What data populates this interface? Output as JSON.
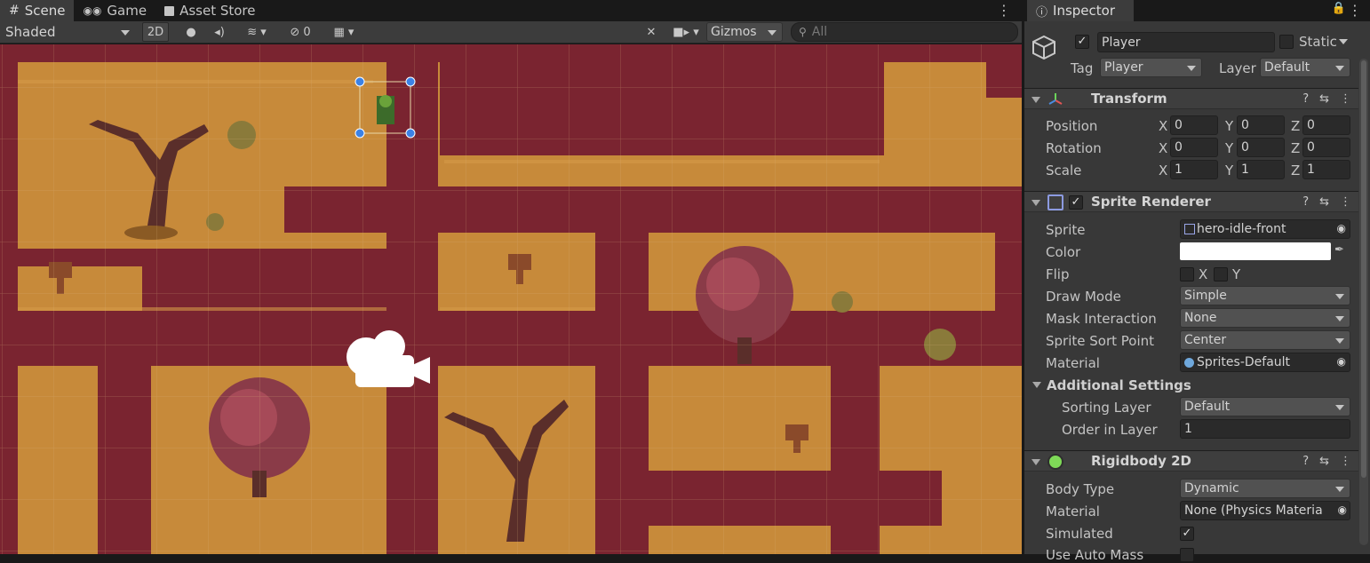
{
  "tabs": [
    {
      "icon": "grid-icon",
      "label": "Scene"
    },
    {
      "icon": "gamepad-icon",
      "label": "Game"
    },
    {
      "icon": "store-bag-icon",
      "label": "Asset Store"
    }
  ],
  "inspector_tab": {
    "label": "Inspector"
  },
  "scene_toolbar": {
    "draw_mode": "Shaded",
    "mode_2d": "2D",
    "hidden_count": "0",
    "gizmos": "Gizmos",
    "search_placeholder": "All"
  },
  "game_object": {
    "name": "Player",
    "static_label": "Static",
    "tag_label": "Tag",
    "tag_value": "Player",
    "layer_label": "Layer",
    "layer_value": "Default"
  },
  "transform": {
    "title": "Transform",
    "rows": [
      {
        "label": "Position",
        "x": "0",
        "y": "0",
        "z": "0"
      },
      {
        "label": "Rotation",
        "x": "0",
        "y": "0",
        "z": "0"
      },
      {
        "label": "Scale",
        "x": "1",
        "y": "1",
        "z": "1"
      }
    ],
    "axis": {
      "x": "X",
      "y": "Y",
      "z": "Z"
    }
  },
  "sprite_renderer": {
    "title": "Sprite Renderer",
    "sprite_label": "Sprite",
    "sprite_value": "hero-idle-front",
    "color_label": "Color",
    "color_value": "#ffffff",
    "flip_label": "Flip",
    "flip_x": "X",
    "flip_y": "Y",
    "draw_mode_label": "Draw Mode",
    "draw_mode_value": "Simple",
    "mask_label": "Mask Interaction",
    "mask_value": "None",
    "sort_point_label": "Sprite Sort Point",
    "sort_point_value": "Center",
    "material_label": "Material",
    "material_value": "Sprites-Default",
    "additional_label": "Additional Settings",
    "sorting_layer_label": "Sorting Layer",
    "sorting_layer_value": "Default",
    "order_label": "Order in Layer",
    "order_value": "1"
  },
  "rigidbody": {
    "title": "Rigidbody 2D",
    "body_type_label": "Body Type",
    "body_type_value": "Dynamic",
    "material_label": "Material",
    "material_value": "None (Physics Materia",
    "simulated_label": "Simulated",
    "auto_mass_label": "Use Auto Mass"
  },
  "colors": {
    "dirt": "#c78a3a",
    "path": "#7a2430",
    "editor_bg": "#383838"
  }
}
